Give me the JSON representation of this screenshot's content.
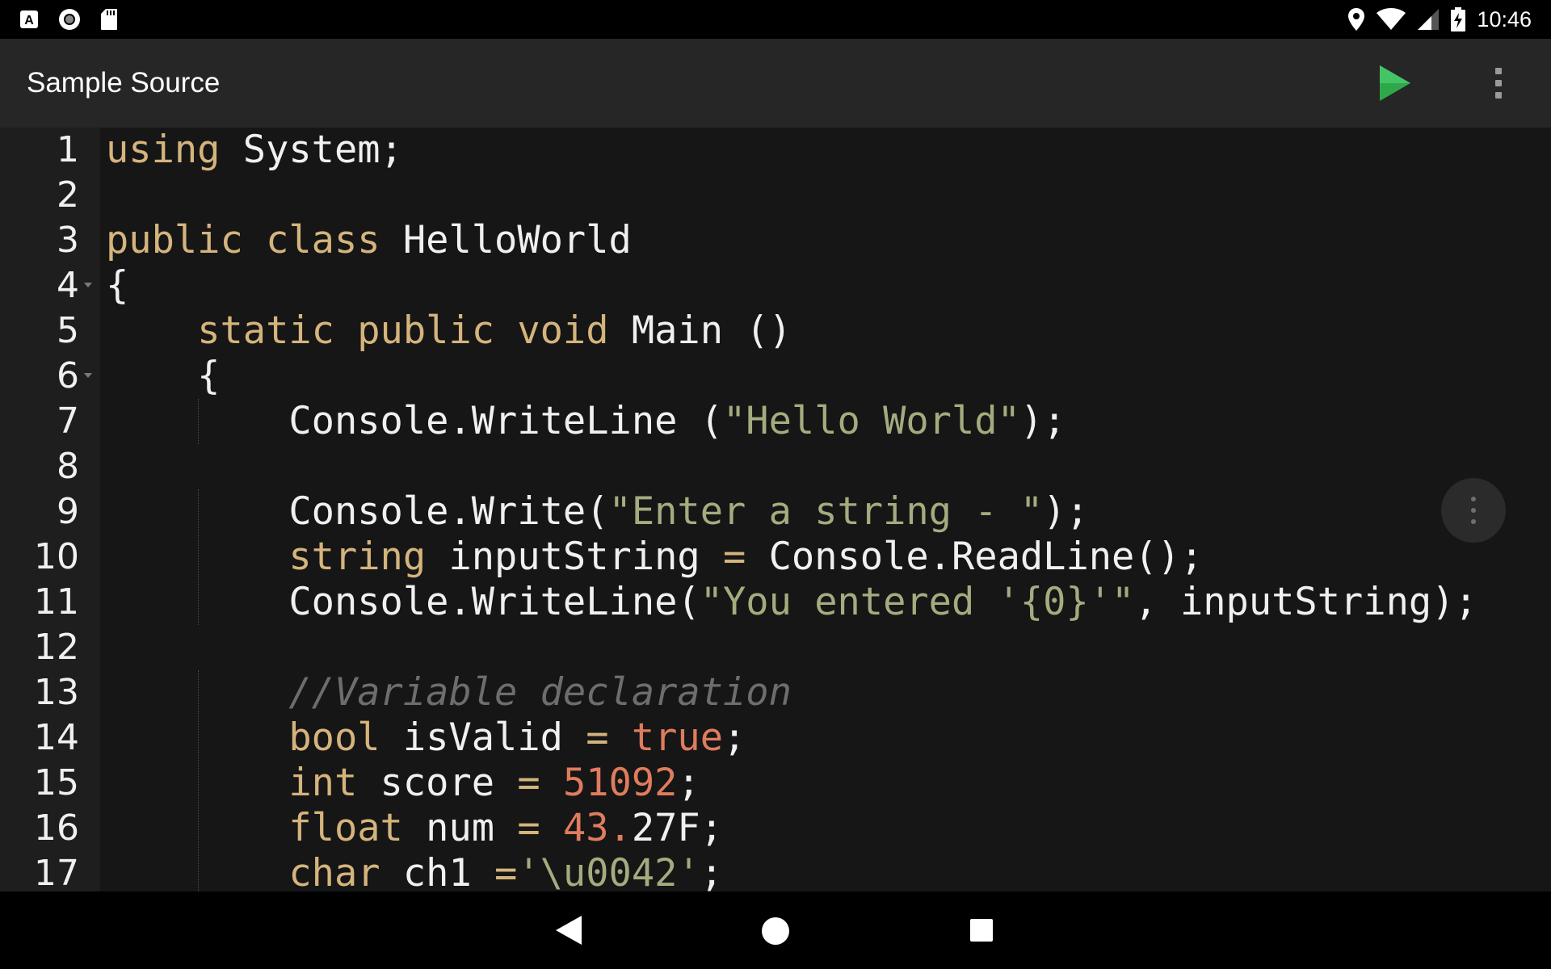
{
  "status_bar": {
    "time": "10:46",
    "left_icons": [
      "a-notification-icon",
      "record-icon",
      "sd-card-icon"
    ],
    "right_icons": [
      "location-icon",
      "wifi-icon",
      "signal-icon",
      "battery-charging-icon"
    ]
  },
  "app_bar": {
    "title": "Sample Source",
    "run_icon": "play-icon",
    "run_color": "#2fa84a",
    "overflow_icon": "more-vertical-icon"
  },
  "editor": {
    "colors": {
      "keyword": "#d5b47c",
      "string": "#a6ab7f",
      "number": "#e07c5e",
      "comment": "#6d6d6d",
      "text": "#f0f0f0",
      "background": "#161616"
    },
    "lines": [
      {
        "n": "1",
        "parts": [
          {
            "t": "using",
            "c": "kw"
          },
          {
            "t": " System;",
            "c": ""
          }
        ]
      },
      {
        "n": "2",
        "parts": []
      },
      {
        "n": "3",
        "parts": [
          {
            "t": "public",
            "c": "kw"
          },
          {
            "t": " ",
            "c": ""
          },
          {
            "t": "class",
            "c": "kw"
          },
          {
            "t": " HelloWorld",
            "c": ""
          }
        ]
      },
      {
        "n": "4",
        "fold": true,
        "parts": [
          {
            "t": "{",
            "c": ""
          }
        ]
      },
      {
        "n": "5",
        "parts": [
          {
            "t": "    ",
            "c": ""
          },
          {
            "t": "static",
            "c": "kw"
          },
          {
            "t": " ",
            "c": ""
          },
          {
            "t": "public",
            "c": "kw"
          },
          {
            "t": " ",
            "c": ""
          },
          {
            "t": "void",
            "c": "kw"
          },
          {
            "t": " Main ()",
            "c": ""
          }
        ]
      },
      {
        "n": "6",
        "fold": true,
        "parts": [
          {
            "t": "    {",
            "c": ""
          }
        ]
      },
      {
        "n": "7",
        "parts": [
          {
            "t": "        Console.WriteLine (",
            "c": ""
          },
          {
            "t": "\"Hello World\"",
            "c": "str"
          },
          {
            "t": ");",
            "c": ""
          }
        ]
      },
      {
        "n": "8",
        "parts": []
      },
      {
        "n": "9",
        "parts": [
          {
            "t": "        Console.Write(",
            "c": ""
          },
          {
            "t": "\"Enter a string - \"",
            "c": "str"
          },
          {
            "t": ");",
            "c": ""
          }
        ]
      },
      {
        "n": "10",
        "parts": [
          {
            "t": "        ",
            "c": ""
          },
          {
            "t": "string",
            "c": "kw"
          },
          {
            "t": " inputString ",
            "c": ""
          },
          {
            "t": "=",
            "c": "kw"
          },
          {
            "t": " Console.ReadLine();",
            "c": ""
          }
        ]
      },
      {
        "n": "11",
        "parts": [
          {
            "t": "        Console.WriteLine(",
            "c": ""
          },
          {
            "t": "\"You entered '{0}'\"",
            "c": "str"
          },
          {
            "t": ", inputString);",
            "c": ""
          }
        ]
      },
      {
        "n": "12",
        "parts": []
      },
      {
        "n": "13",
        "parts": [
          {
            "t": "        ",
            "c": ""
          },
          {
            "t": "//Variable declaration",
            "c": "cm"
          }
        ]
      },
      {
        "n": "14",
        "parts": [
          {
            "t": "        ",
            "c": ""
          },
          {
            "t": "bool",
            "c": "kw"
          },
          {
            "t": " isValid ",
            "c": ""
          },
          {
            "t": "=",
            "c": "kw"
          },
          {
            "t": " ",
            "c": ""
          },
          {
            "t": "true",
            "c": "num"
          },
          {
            "t": ";",
            "c": ""
          }
        ]
      },
      {
        "n": "15",
        "parts": [
          {
            "t": "        ",
            "c": ""
          },
          {
            "t": "int",
            "c": "kw"
          },
          {
            "t": " score ",
            "c": ""
          },
          {
            "t": "=",
            "c": "kw"
          },
          {
            "t": " ",
            "c": ""
          },
          {
            "t": "51092",
            "c": "num"
          },
          {
            "t": ";",
            "c": ""
          }
        ]
      },
      {
        "n": "16",
        "parts": [
          {
            "t": "        ",
            "c": ""
          },
          {
            "t": "float",
            "c": "kw"
          },
          {
            "t": " num ",
            "c": ""
          },
          {
            "t": "=",
            "c": "kw"
          },
          {
            "t": " ",
            "c": ""
          },
          {
            "t": "43.",
            "c": "num"
          },
          {
            "t": "27F;",
            "c": ""
          }
        ]
      },
      {
        "n": "17",
        "parts": [
          {
            "t": "        ",
            "c": ""
          },
          {
            "t": "char",
            "c": "kw"
          },
          {
            "t": " ch1 ",
            "c": ""
          },
          {
            "t": "=",
            "c": "kw"
          },
          {
            "t": "'\\u0042'",
            "c": "str"
          },
          {
            "t": ";",
            "c": ""
          }
        ]
      }
    ]
  },
  "fab": {
    "icon": "more-vertical-icon"
  },
  "nav_bar": {
    "icons": [
      "back-icon",
      "home-icon",
      "recents-icon"
    ]
  }
}
